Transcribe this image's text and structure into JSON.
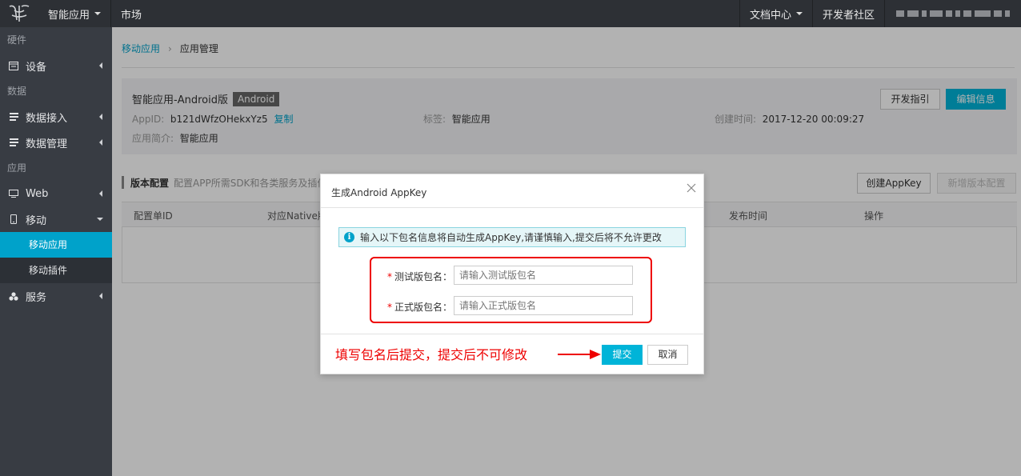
{
  "topbar": {
    "app_menu": "智能应用",
    "market": "市场",
    "docs": "文档中心",
    "community": "开发者社区"
  },
  "sidebar": {
    "group_hardware": "硬件",
    "item_device": "设备",
    "group_data": "数据",
    "item_data_access": "数据接入",
    "item_data_manage": "数据管理",
    "group_app": "应用",
    "item_web": "Web",
    "item_mobile": "移动",
    "sub_mobile_app": "移动应用",
    "sub_mobile_plugin": "移动插件",
    "item_service": "服务"
  },
  "breadcrumb": {
    "parent": "移动应用",
    "separator": "›",
    "current": "应用管理"
  },
  "app": {
    "name": "智能应用-Android版",
    "platform_tag": "Android",
    "appid_label": "AppID:",
    "appid_value": "b121dWfzOHekxYz5",
    "copy": "复制",
    "tag_label": "标签:",
    "tag_value": "智能应用",
    "created_label": "创建时间:",
    "created_value": "2017-12-20 00:09:27",
    "desc_label": "应用简介:",
    "desc_value": "智能应用",
    "btn_guide": "开发指引",
    "btn_edit": "编辑信息"
  },
  "version": {
    "title": "版本配置",
    "desc": "配置APP所需SDK和各类服务及插件",
    "btn_create_key": "创建AppKey",
    "btn_new_version": "新增版本配置",
    "columns": [
      "配置单ID",
      "对应Native版本",
      "发布时间",
      "操作"
    ]
  },
  "dialog": {
    "title": "生成Android AppKey",
    "notice": "输入以下包名信息将自动生成AppKey,请谨慎输入,提交后将不允许更改",
    "test_label": "测试版包名：",
    "test_placeholder": "请输入测试版包名",
    "prod_label": "正式版包名：",
    "prod_placeholder": "请输入正式版包名",
    "annotation": "填写包名后提交，提交后不可修改",
    "btn_submit": "提交",
    "btn_cancel": "取消"
  },
  "colors": {
    "accent": "#00b4d8",
    "annotation_red": "#e00000"
  }
}
